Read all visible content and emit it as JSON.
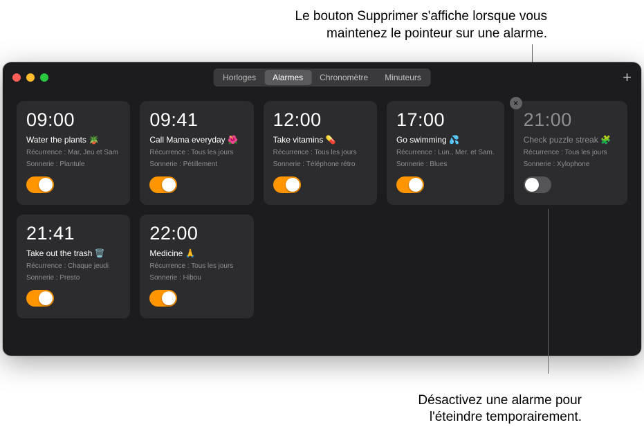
{
  "callouts": {
    "top_line1": "Le bouton Supprimer s'affiche lorsque vous",
    "top_line2": "maintenez le pointeur sur une alarme.",
    "bottom_line1": "Désactivez une alarme pour",
    "bottom_line2": "l'éteindre temporairement."
  },
  "tabs": {
    "horloges": "Horloges",
    "alarmes": "Alarmes",
    "chrono": "Chronomètre",
    "minuteurs": "Minuteurs"
  },
  "add_label": "+",
  "delete_label": "×",
  "alarms": [
    {
      "time": "09:00",
      "label": "Water the plants 🪴",
      "recurrence": "Récurrence : Mar, Jeu et Sam",
      "sound": "Sonnerie : Plantule",
      "enabled": true,
      "hover": false
    },
    {
      "time": "09:41",
      "label": "Call Mama everyday 🌺",
      "recurrence": "Récurrence : Tous les jours",
      "sound": "Sonnerie : Pétillement",
      "enabled": true,
      "hover": false
    },
    {
      "time": "12:00",
      "label": "Take vitamins 💊",
      "recurrence": "Récurrence : Tous les jours",
      "sound": "Sonnerie : Téléphone rétro",
      "enabled": true,
      "hover": false
    },
    {
      "time": "17:00",
      "label": "Go swimming 💦",
      "recurrence": "Récurrence : Lun., Mer. et Sam.",
      "sound": "Sonnerie : Blues",
      "enabled": true,
      "hover": false
    },
    {
      "time": "21:00",
      "label": "Check puzzle streak 🧩",
      "recurrence": "Récurrence : Tous les jours",
      "sound": "Sonnerie : Xylophone",
      "enabled": false,
      "hover": true
    },
    {
      "time": "21:41",
      "label": "Take out the trash 🗑️",
      "recurrence": "Récurrence : Chaque jeudi",
      "sound": "Sonnerie : Presto",
      "enabled": true,
      "hover": false
    },
    {
      "time": "22:00",
      "label": "Medicine 🙏",
      "recurrence": "Récurrence : Tous les jours",
      "sound": "Sonnerie : Hibou",
      "enabled": true,
      "hover": false
    }
  ]
}
